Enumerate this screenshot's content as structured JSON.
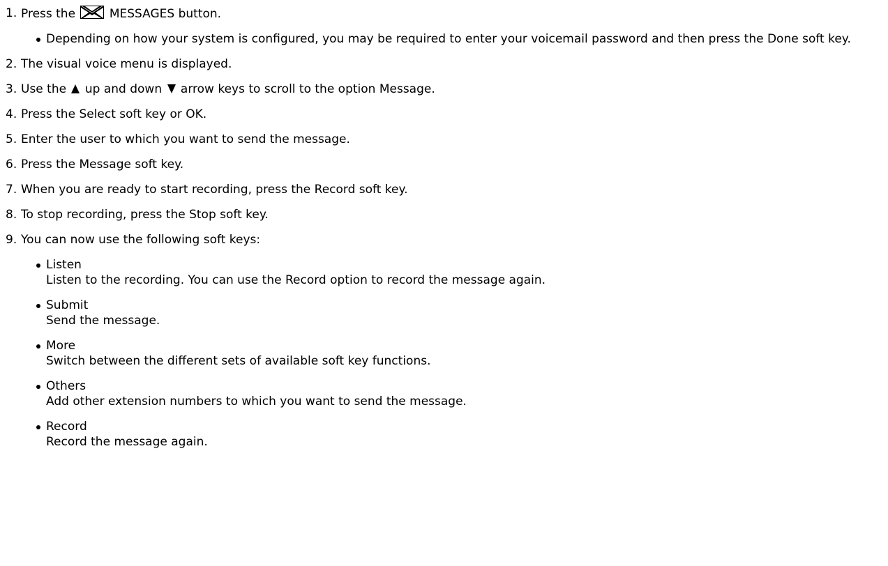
{
  "steps": [
    {
      "num": "1.",
      "text_before": "Press the",
      "icon": "envelope-icon",
      "text_after": "MESSAGES button.",
      "bullets": [
        "Depending on how your system is configured, you may be required to enter your voicemail password and then press the Done soft key."
      ]
    },
    {
      "num": "2.",
      "text": "The visual voice menu is displayed."
    },
    {
      "num": "3.",
      "text_a": "Use the",
      "icon_up": "up-arrow-icon",
      "text_b": "up and down",
      "icon_down": "down-arrow-icon",
      "text_c": "arrow keys to scroll to the option Message."
    },
    {
      "num": "4.",
      "text": "Press the Select soft key or OK."
    },
    {
      "num": "5.",
      "text": "Enter the user to which you want to send the message."
    },
    {
      "num": "6.",
      "text": "Press the Message soft key."
    },
    {
      "num": "7.",
      "text": "When you are ready to start recording, press the Record soft key."
    },
    {
      "num": "8.",
      "text": "To stop recording, press the Stop soft key."
    },
    {
      "num": "9.",
      "text": "You can now use the following soft keys:",
      "keys": [
        {
          "term": "Listen",
          "desc": "Listen to the recording. You can use the Record option to record the message again."
        },
        {
          "term": "Submit",
          "desc": "Send the message."
        },
        {
          "term": "More",
          "desc": "Switch between the different sets of available soft key functions."
        },
        {
          "term": "Others",
          "desc": "Add other extension numbers to which you want to send the message."
        },
        {
          "term": "Record",
          "desc": "Record the message again."
        }
      ]
    }
  ],
  "colors": {
    "text": "#000000",
    "background": "#ffffff"
  }
}
